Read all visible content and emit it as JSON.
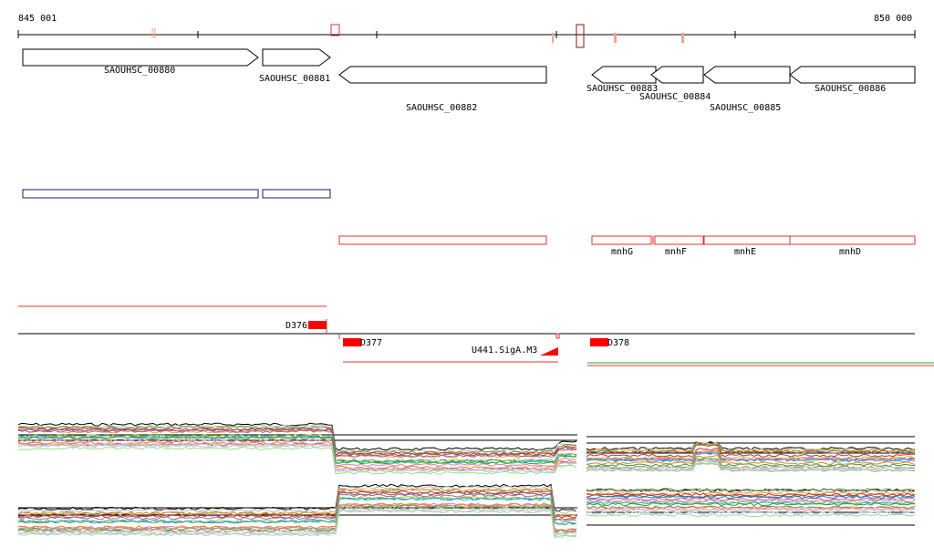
{
  "ruler": {
    "start_label": "845 001",
    "end_label": "850 000"
  },
  "genes": [
    {
      "name": "SAOUHSC_00880",
      "strand": "+"
    },
    {
      "name": "SAOUHSC_00881",
      "strand": "+"
    },
    {
      "name": "SAOUHSC_00882",
      "strand": "-"
    },
    {
      "name": "SAOUHSC_00883",
      "strand": "-"
    },
    {
      "name": "SAOUHSC_00884",
      "strand": "-"
    },
    {
      "name": "SAOUHSC_00885",
      "strand": "-"
    },
    {
      "name": "SAOUHSC_00886",
      "strand": "-"
    }
  ],
  "operon_labels": {
    "mnhG": "mnhG",
    "mnhF": "mnhF",
    "mnhE": "mnhE",
    "mnhD": "mnhD"
  },
  "promoters": {
    "d376": "D376",
    "d377": "D377",
    "u441": "U441.SigA.M3",
    "d378": "D378"
  },
  "colors": {
    "gene_outline": "#000000",
    "operon_plus": "#1a1a6e",
    "operon_minus": "#e03030",
    "feature_red": "#ff0000",
    "highlight": "#f4a58a",
    "green_line": "#2ea02e"
  },
  "panel_series_colors": [
    "#000000",
    "#b5b5b5",
    "#6a8e23",
    "#e6a23c",
    "#d62728",
    "#8c564b",
    "#9467bd",
    "#1f77b4",
    "#bcbd22",
    "#17becf",
    "#e377c2",
    "#2ca02c",
    "#ff7f0e",
    "#7f7f7f",
    "#c49c94",
    "#f7b6d2",
    "#aec7e8",
    "#98df8a"
  ]
}
